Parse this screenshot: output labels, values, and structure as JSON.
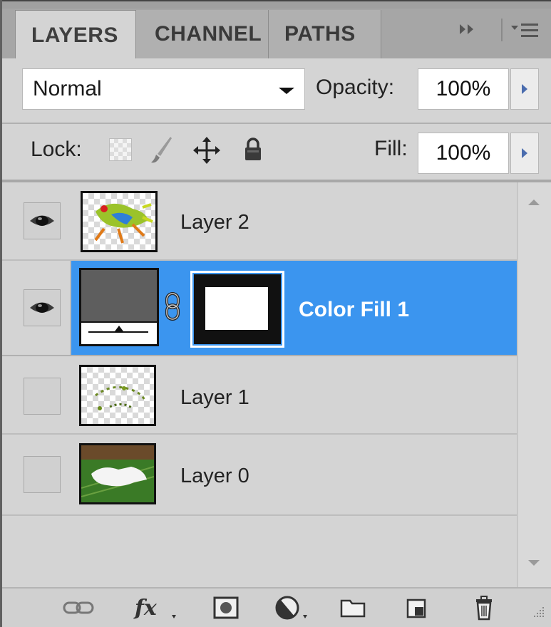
{
  "tabs": [
    {
      "label": "LAYERS",
      "active": true
    },
    {
      "label": "CHANNEL",
      "active": false
    },
    {
      "label": "PATHS",
      "active": false
    }
  ],
  "tab_controls": {
    "collapse_icon": "double-chevron-right-icon",
    "menu_icon": "panel-menu-icon"
  },
  "blend": {
    "mode": "Normal",
    "opacity_label": "Opacity:",
    "opacity_value": "100%"
  },
  "lock": {
    "label": "Lock:",
    "icons": [
      "lock-transparent-pixels-icon",
      "lock-image-pixels-icon",
      "lock-position-icon",
      "lock-all-icon"
    ],
    "fill_label": "Fill:",
    "fill_value": "100%"
  },
  "layers": [
    {
      "name": "Layer 2",
      "visible": true,
      "selected": false,
      "thumb": "frog-transparent"
    },
    {
      "name": "Color Fill 1",
      "visible": true,
      "selected": true,
      "thumb": "color-fill",
      "has_mask": true,
      "linked": true
    },
    {
      "name": "Layer 1",
      "visible": false,
      "selected": false,
      "thumb": "frog-outline-transparent"
    },
    {
      "name": "Layer 0",
      "visible": false,
      "selected": false,
      "thumb": "leaf-photo"
    }
  ],
  "colors": {
    "selection": "#3b95ef",
    "panel": "#d4d4d4",
    "fill_swatch": "#5e5e5e"
  },
  "toolbar": [
    "link-layers-icon",
    "fx-layer-style-icon",
    "add-mask-icon",
    "adjustment-layer-icon",
    "new-group-icon",
    "new-layer-icon",
    "delete-layer-icon"
  ]
}
